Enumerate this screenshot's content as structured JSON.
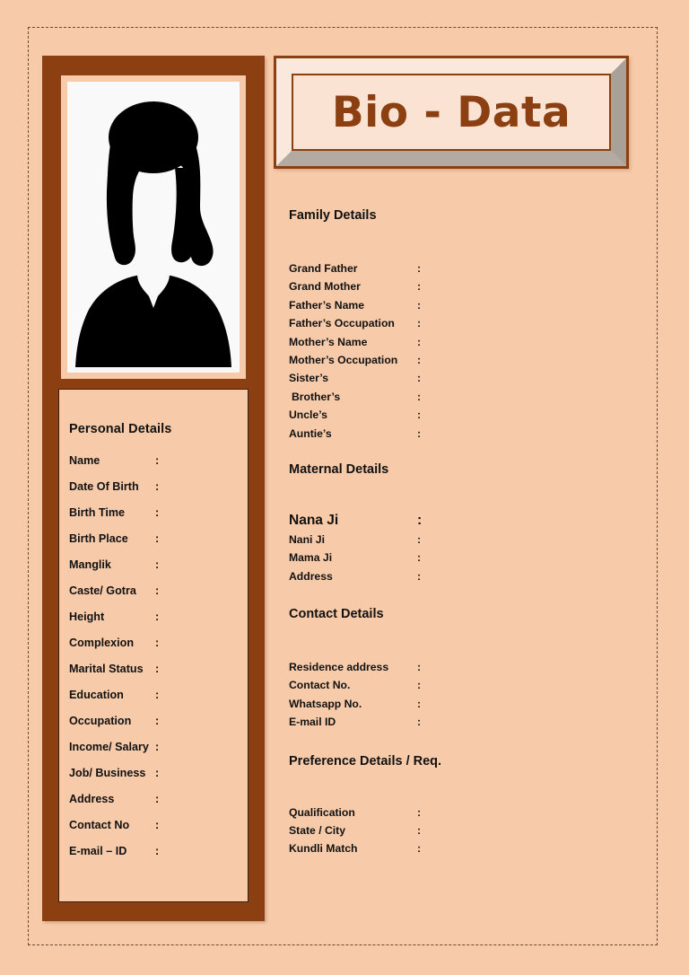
{
  "page": {
    "background_color": "#f7cbaa",
    "frame_color": "#8c3f10",
    "panel_color": "#fbe3d4"
  },
  "title": {
    "text": "Bio - Data"
  },
  "photo": {
    "alt": "female-silhouette-placeholder"
  },
  "personal_details": {
    "heading": "Personal Details",
    "separator": ":",
    "rows": [
      {
        "label": "Name"
      },
      {
        "label": "Date Of Birth"
      },
      {
        "label": "Birth Time"
      },
      {
        "label": "Birth Place"
      },
      {
        "label": "Manglik"
      },
      {
        "label": "Caste/ Gotra"
      },
      {
        "label": "Height"
      },
      {
        "label": "Complexion"
      },
      {
        "label": "Marital Status"
      },
      {
        "label": "Education"
      },
      {
        "label": "Occupation"
      },
      {
        "label": "Income/ Salary"
      },
      {
        "label": "Job/ Business"
      },
      {
        "label": "Address"
      },
      {
        "label": "Contact No"
      },
      {
        "label": "E-mail – ID"
      }
    ]
  },
  "family_details": {
    "heading": "Family Details",
    "separator": ":",
    "rows": [
      {
        "label": "Grand Father"
      },
      {
        "label": "Grand Mother"
      },
      {
        "label": "Father’s Name"
      },
      {
        "label": "Father’s Occupation"
      },
      {
        "label": "Mother’s Name"
      },
      {
        "label": "Mother’s Occupation"
      },
      {
        "label": "Sister’s"
      },
      {
        "label": "Brother’s"
      },
      {
        "label": "Uncle’s"
      },
      {
        "label": "Auntie’s"
      }
    ]
  },
  "maternal_details": {
    "heading": "Maternal Details",
    "separator": ":",
    "rows": [
      {
        "label": "Nana Ji"
      },
      {
        "label": "Nani Ji"
      },
      {
        "label": "Mama Ji"
      },
      {
        "label": "Address"
      }
    ]
  },
  "contact_details": {
    "heading": "Contact Details",
    "separator": ":",
    "rows": [
      {
        "label": "Residence address"
      },
      {
        "label": "Contact No."
      },
      {
        "label": "Whatsapp No."
      },
      {
        "label": "E-mail ID"
      }
    ]
  },
  "preference_details": {
    "heading": "Preference Details / Req.",
    "separator": ":",
    "rows": [
      {
        "label": "Qualification"
      },
      {
        "label": "State / City"
      },
      {
        "label": "Kundli Match"
      }
    ]
  }
}
